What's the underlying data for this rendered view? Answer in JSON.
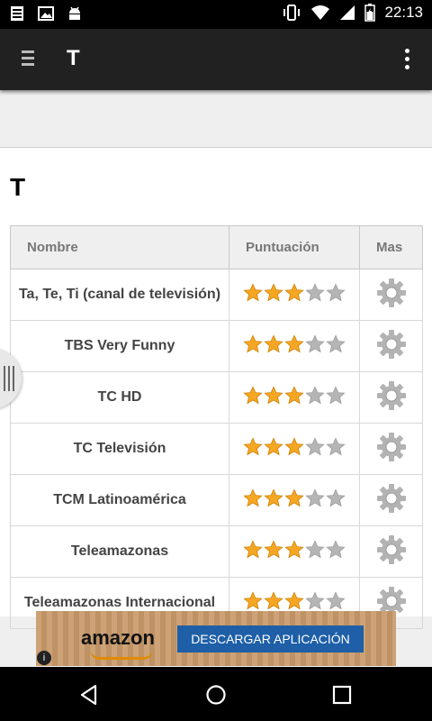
{
  "status_bar": {
    "time": "22:13",
    "icons": [
      "notes-icon",
      "image-icon",
      "android-icon",
      "vibrate-icon",
      "wifi-icon",
      "signal-icon",
      "battery-icon"
    ]
  },
  "app_bar": {
    "title": "T"
  },
  "section": {
    "title": "T"
  },
  "table": {
    "headers": [
      "Nombre",
      "Puntuación",
      "Mas"
    ],
    "rows": [
      {
        "name": "Ta, Te, Ti (canal de televisión)",
        "rating": 3,
        "max_rating": 5
      },
      {
        "name": "TBS Very Funny",
        "rating": 3,
        "max_rating": 5
      },
      {
        "name": "TC HD",
        "rating": 3,
        "max_rating": 5
      },
      {
        "name": "TC Televisión",
        "rating": 3,
        "max_rating": 5
      },
      {
        "name": "TCM Latinoamérica",
        "rating": 3,
        "max_rating": 5
      },
      {
        "name": "Teleamazonas",
        "rating": 3,
        "max_rating": 5
      },
      {
        "name": "Teleamazonas Internacional",
        "rating": 3,
        "max_rating": 5
      }
    ]
  },
  "ad": {
    "brand": "amazon",
    "button_label": "DESCARGAR APLICACIÓN",
    "info_label": "i"
  },
  "colors": {
    "star_filled": "#f5a623",
    "star_empty": "#b5b5b5",
    "app_bar": "#212121",
    "ad_button": "#1e5fa7"
  }
}
